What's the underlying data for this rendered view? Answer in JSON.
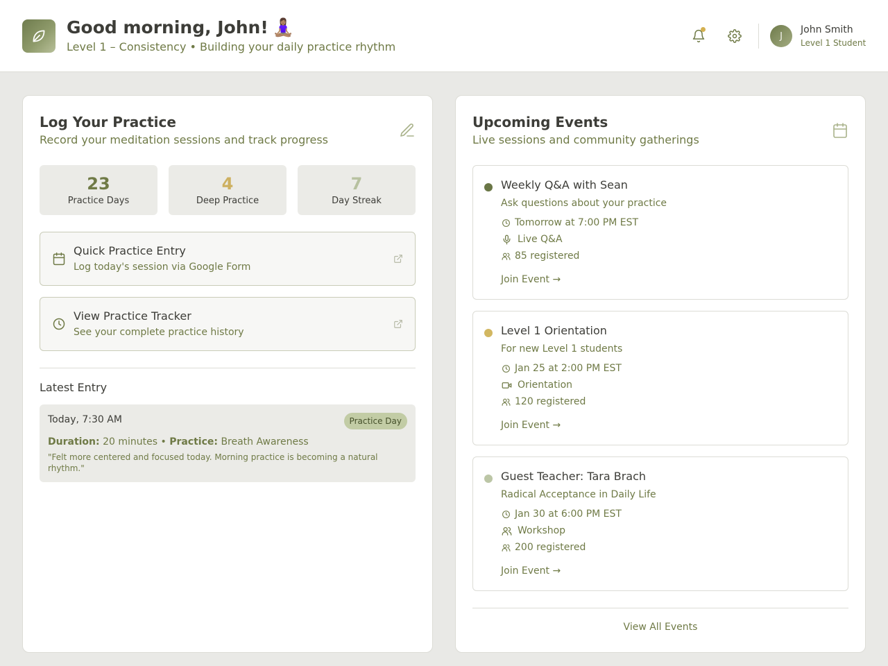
{
  "header": {
    "greeting": "Good morning, John!",
    "greeting_emoji": "🧘🏽‍♀️",
    "subtitle": "Level 1 – Consistency • Building your daily practice rhythm",
    "logo_icon": "leaf-icon",
    "notification_icon": "bell-icon",
    "settings_icon": "gear-icon",
    "user": {
      "initial": "J",
      "name": "John Smith",
      "role": "Level 1 Student"
    }
  },
  "practice": {
    "title": "Log Your Practice",
    "subtitle": "Record your meditation sessions and track progress",
    "icon": "pencil-icon",
    "stats": [
      {
        "value": "23",
        "label": "Practice Days"
      },
      {
        "value": "4",
        "label": "Deep Practice"
      },
      {
        "value": "7",
        "label": "Day Streak"
      }
    ],
    "actions": [
      {
        "title": "Quick Practice Entry",
        "subtitle": "Log today's session via Google Form",
        "icon": "calendar-icon"
      },
      {
        "title": "View Practice Tracker",
        "subtitle": "See your complete practice history",
        "icon": "clock-icon"
      }
    ],
    "latest_label": "Latest Entry",
    "latest_entry": {
      "time": "Today, 7:30 AM",
      "badge": "Practice Day",
      "duration_label": "Duration:",
      "duration": "20 minutes",
      "separator": "•",
      "practice_label": "Practice:",
      "practice": "Breath Awareness",
      "note": "\"Felt more centered and focused today. Morning practice is becoming a natural rhythm.\""
    }
  },
  "events": {
    "title": "Upcoming Events",
    "subtitle": "Live sessions and community gatherings",
    "icon": "calendar-icon",
    "items": [
      {
        "title": "Weekly Q&A with Sean",
        "subtitle": "Ask questions about your practice",
        "when": "Tomorrow at 7:00 PM EST",
        "type": "Live Q&A",
        "type_icon": "microphone-icon",
        "registered": "85 registered",
        "join": "Join Event →",
        "dot_color": "#6a7646"
      },
      {
        "title": "Level 1 Orientation",
        "subtitle": "For new Level 1 students",
        "when": "Jan 25 at 2:00 PM EST",
        "type": "Orientation",
        "type_icon": "video-icon",
        "registered": "120 registered",
        "join": "Join Event →",
        "dot_color": "#d2b761"
      },
      {
        "title": "Guest Teacher: Tara Brach",
        "subtitle": "Radical Acceptance in Daily Life",
        "when": "Jan 30 at 6:00 PM EST",
        "type": "Workshop",
        "type_icon": "users-icon",
        "registered": "200 registered",
        "join": "Join Event →",
        "dot_color": "#bcc6a6"
      }
    ],
    "view_all": "View All Events"
  },
  "colors": {
    "accent": "#6f7a46",
    "gold": "#d4b04f",
    "background": "#e9e9e6"
  }
}
